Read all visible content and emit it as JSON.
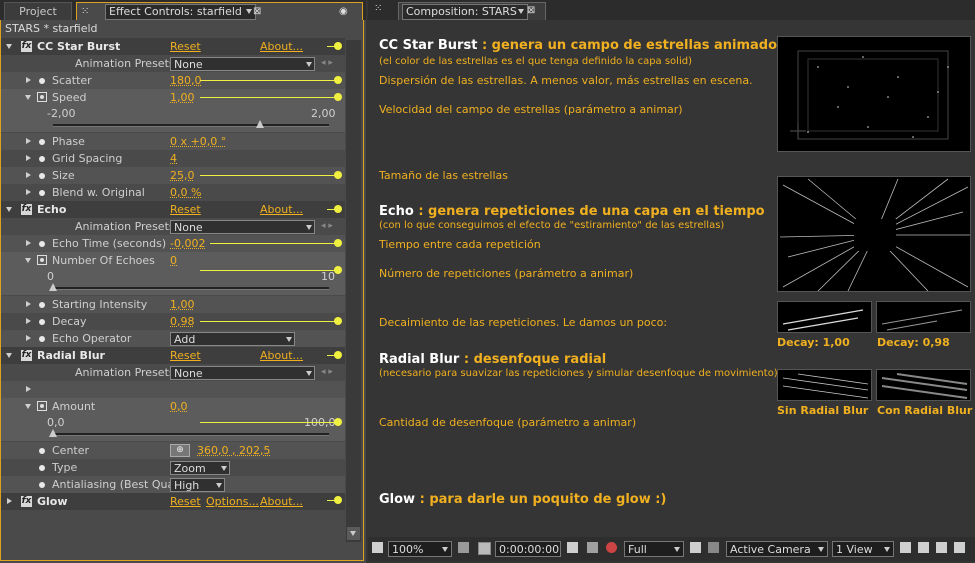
{
  "tabs": {
    "project": "Project",
    "effect_controls": "Effect Controls: starfield",
    "composition": "Composition: STARS"
  },
  "layer_title": "STARS * starfield",
  "common": {
    "reset": "Reset",
    "about": "About...",
    "options": "Options...",
    "presets_label": "Animation Presets:",
    "presets_value": "None"
  },
  "effects": {
    "ccstar": {
      "name": "CC Star Burst",
      "scatter": {
        "label": "Scatter",
        "value": "180,0"
      },
      "speed": {
        "label": "Speed",
        "value": "1,00",
        "min": "-2,00",
        "max": "2,00",
        "level": 0.75
      },
      "phase": {
        "label": "Phase",
        "value": "0 x +0,0 °"
      },
      "grid": {
        "label": "Grid Spacing",
        "value": "4"
      },
      "size": {
        "label": "Size",
        "value": "25,0"
      },
      "blend": {
        "label": "Blend w. Original",
        "value": "0,0 %"
      }
    },
    "echo": {
      "name": "Echo",
      "time": {
        "label": "Echo Time (seconds)",
        "value": "-0,002"
      },
      "number": {
        "label": "Number Of Echoes",
        "value": "0",
        "min": "0",
        "max": "10",
        "level": 0.0
      },
      "intensity": {
        "label": "Starting Intensity",
        "value": "1,00"
      },
      "decay": {
        "label": "Decay",
        "value": "0,98"
      },
      "operator": {
        "label": "Echo Operator",
        "value": "Add"
      }
    },
    "radial": {
      "name": "Radial Blur",
      "amount": {
        "label": "Amount",
        "value": "0,0",
        "min": "0,0",
        "max": "100,0",
        "level": 0.0
      },
      "center": {
        "label": "Center",
        "value": "360,0 , 202,5"
      },
      "type": {
        "label": "Type",
        "value": "Zoom"
      },
      "aa": {
        "label": "Antialiasing (Best Quali",
        "value": "High"
      }
    },
    "glow": {
      "name": "Glow"
    }
  },
  "annotations": {
    "ccstar_title": "CC Star Burst",
    "ccstar_desc": ": genera un campo de estrellas animado en el eje Z",
    "ccstar_sub": "(el color de las estrellas es el que tenga definido la capa solid)",
    "scatter": "Dispersión de las estrellas. A menos valor, más estrellas en escena.",
    "speed": "Velocidad del campo de estrellas (parámetro a animar)",
    "size": "Tamaño de las estrellas",
    "echo_title": "Echo",
    "echo_desc": ": genera repeticiones de una capa en el tiempo",
    "echo_sub": "(con lo que conseguimos el efecto de \"estiramiento\" de las estrellas)",
    "echo_time": "Tiempo entre cada repetición",
    "echoes": "Número de repeticiones (parámetro a animar)",
    "decay": "Decaimiento de las repeticiones. Le damos un poco:",
    "radial_title": "Radial Blur",
    "radial_desc": ": desenfoque radial",
    "radial_sub": "(necesario para suavizar las repeticiones y simular desenfoque de movimiento)",
    "amount": "Cantidad de desenfoque (parámetro a animar)",
    "glow_title": "Glow",
    "glow_desc": ": para darle un poquito de glow :)"
  },
  "captions": {
    "decay1": "Decay: 1,00",
    "decay2": "Decay: 0,98",
    "sinblur": "Sin Radial Blur",
    "conblur": "Con Radial Blur"
  },
  "viewer": {
    "zoom": "100%",
    "timecode": "0:00:00:00",
    "resolution": "Full",
    "camera": "Active Camera",
    "view": "1 View"
  }
}
